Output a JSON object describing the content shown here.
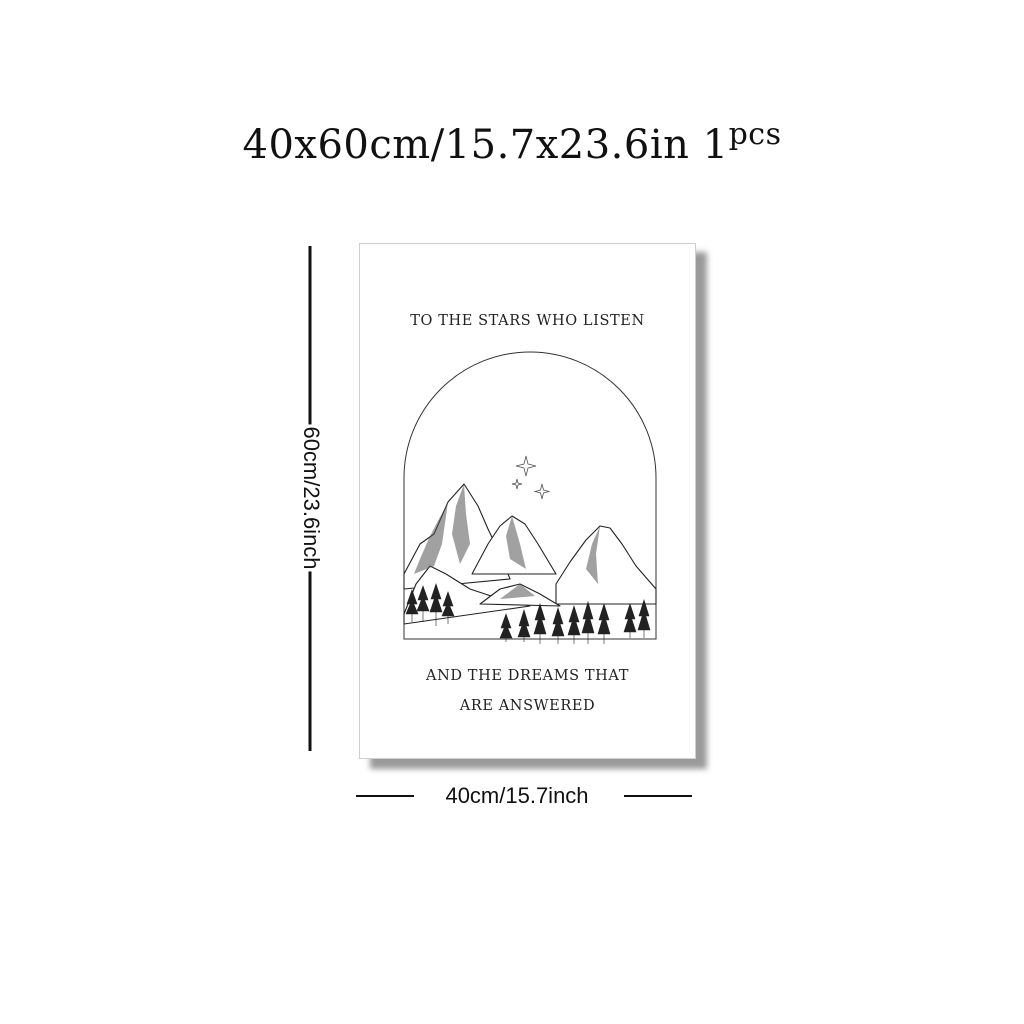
{
  "header": {
    "size_text": "40x60cm/15.7x23.6in",
    "quantity": "1",
    "quantity_suffix": "pcs"
  },
  "poster": {
    "line1": "TO THE STARS WHO LISTEN",
    "line2": "AND THE DREAMS THAT",
    "line3": "ARE ANSWERED"
  },
  "dimensions": {
    "height_label": "60cm/23.6inch",
    "width_label": "40cm/15.7inch"
  },
  "colors": {
    "ink": "#111111",
    "background": "#ffffff"
  }
}
